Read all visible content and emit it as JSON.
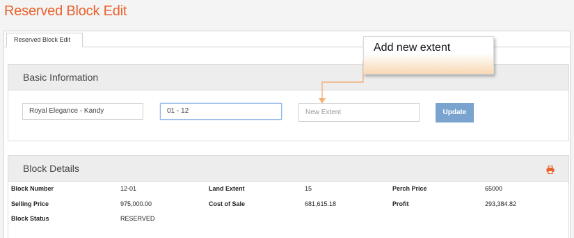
{
  "page": {
    "title": "Reserved Block Edit"
  },
  "tabs": [
    {
      "label": "Reserved Block Edit"
    }
  ],
  "basic_info": {
    "heading": "Basic Information",
    "project_value": "Royal Elegance - Kandy",
    "block_value": "01 - 12",
    "extent_placeholder": "New Extent",
    "update_label": "Update"
  },
  "callout": {
    "text": "Add new extent"
  },
  "block_details": {
    "heading": "Block Details",
    "rows": [
      [
        {
          "label": "Block Number",
          "value": "12-01"
        },
        {
          "label": "Land Extent",
          "value": "15"
        },
        {
          "label": "Perch Price",
          "value": "65000"
        }
      ],
      [
        {
          "label": "Selling Price",
          "value": "975,000.00"
        },
        {
          "label": "Cost of Sale",
          "value": "681,615.18"
        },
        {
          "label": "Profit",
          "value": "293,384.82"
        }
      ],
      [
        {
          "label": "Block Status",
          "value": "RESERVED"
        }
      ]
    ]
  },
  "icons": {
    "print": "print-icon"
  },
  "colors": {
    "title": "#e8612c",
    "button": "#7aa4cf",
    "callout_gradient": "#f8d9b4",
    "arrow": "#f2b27a"
  }
}
